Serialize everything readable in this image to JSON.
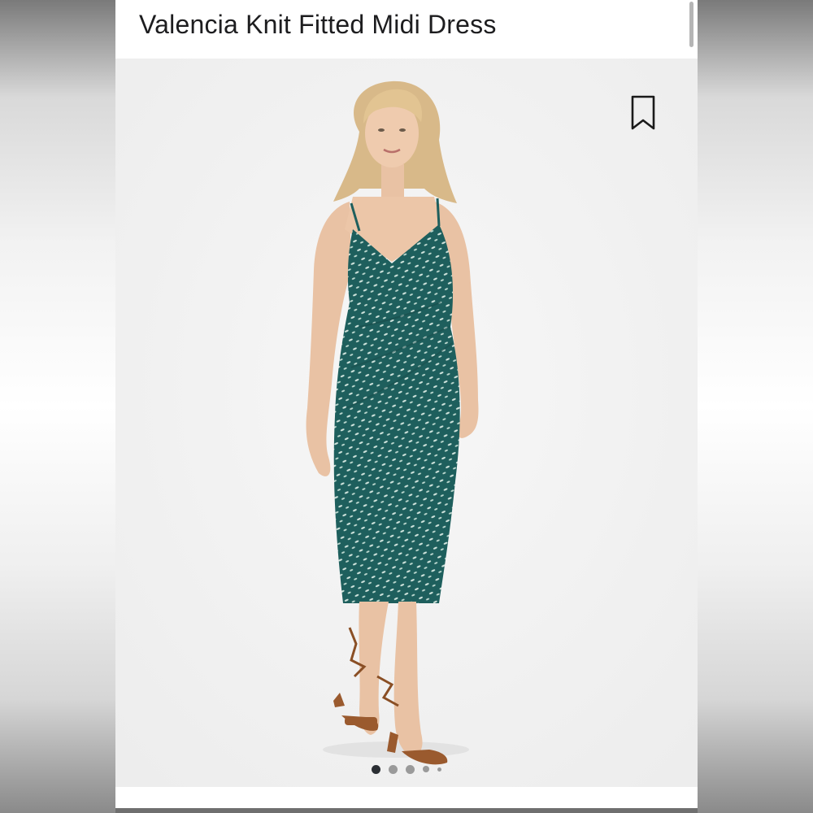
{
  "product": {
    "title": "Valencia Knit Fitted Midi Dress"
  },
  "gallery": {
    "image_alt": "Model wearing teal printed midi dress with brown lace-up sandals",
    "bookmark_icon": "bookmark-icon",
    "page_count": 5,
    "active_index": 0
  },
  "colors": {
    "dress": "#1e5f5d",
    "background": "#f4f4f4",
    "text": "#1d1d1f",
    "sandal": "#9a5a2e"
  }
}
